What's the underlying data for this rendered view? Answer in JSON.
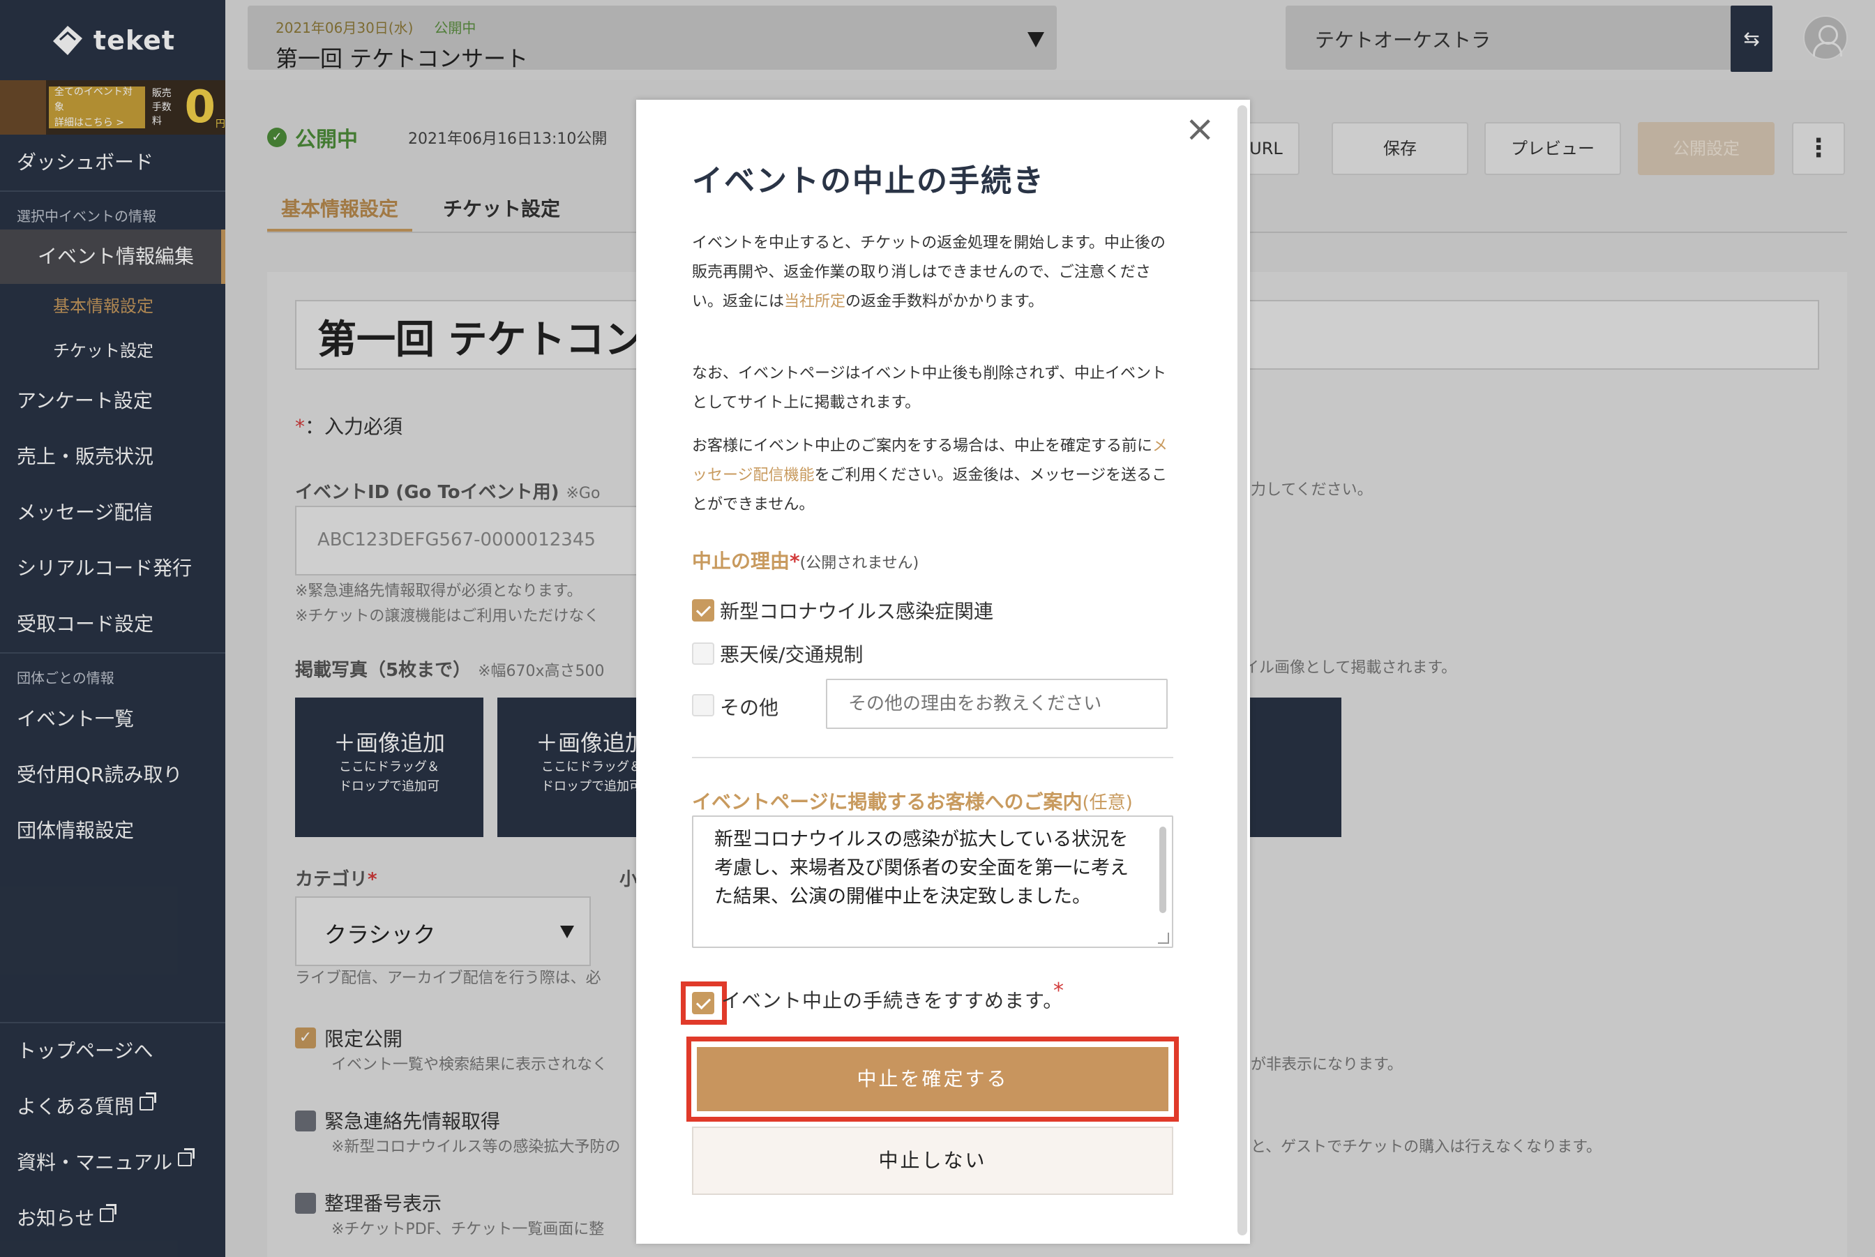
{
  "sidebar": {
    "brand": "teket",
    "banner": {
      "line1": "全てのイベント対象",
      "line2": "詳細はこちら >",
      "fee_label_1": "販売",
      "fee_label_2": "手数料",
      "zero": "0",
      "yen": "円"
    },
    "dashboard": "ダッシュボード",
    "section_event": "選択中イベントの情報",
    "active_item": "イベント情報編集",
    "sub_basic": "基本情報設定",
    "sub_ticket": "チケット設定",
    "items_event": [
      "アンケート設定",
      "売上・販売状況",
      "メッセージ配信",
      "シリアルコード発行",
      "受取コード設定"
    ],
    "section_group": "団体ごとの情報",
    "items_group": [
      "イベント一覧",
      "受付用QR読み取り",
      "団体情報設定"
    ],
    "footer_items": [
      "トップページへ",
      "よくある質問",
      "資料・マニュアル",
      "お知らせ"
    ]
  },
  "topbar": {
    "event_date": "2021年06月30日(水)",
    "event_status": "公開中",
    "event_name": "第一回 テケトコンサート",
    "org_name": "テケトオーケストラ",
    "switch_icon": "⇆"
  },
  "main": {
    "status": "公開中",
    "status_icon": "✓",
    "published_at": "2021年06月16日13:10公開",
    "buttons": {
      "url": "トURL",
      "save": "保存",
      "preview": "プレビュー",
      "publish": "公開設定",
      "more": "⋮"
    },
    "tabs": [
      "基本情報設定",
      "チケット設定"
    ],
    "title_value": "第一回 テケトコン",
    "req_star": "*",
    "req_note": "：入力必須",
    "event_id_label": "イベントID (Go Toイベント用)",
    "event_id_help": "※Go",
    "event_id_help_right": "力してください。",
    "event_id_value": "ABC123DEFG567-0000012345",
    "id_notes": [
      "※緊急連絡先情報取得が必須となります。",
      "※チケットの譲渡機能はご利用いただけなく"
    ],
    "photos_label": "掲載写真（5枚まで）",
    "photos_help": "※幅670x高さ500",
    "photos_help_right": "イル画像として掲載されます。",
    "photo_add": "＋画像追加",
    "photo_drop_1": "ここにドラッグ＆",
    "photo_drop_2": "ドロップで追加可",
    "category_label": "カテゴリ",
    "category_star": "*",
    "subcategory_label": "小",
    "category_value": "クラシック",
    "category_help": "ライブ配信、アーカイブ配信を行う際は、必",
    "limited_label": "限定公開",
    "limited_help": "イベント一覧や検索結果に表示されなく",
    "limited_help_right": "が非表示になります。",
    "emergency_label": "緊急連絡先情報取得",
    "emergency_help": "※新型コロナウイルス等の感染拡大予防の",
    "emergency_help_right": "と、ゲストでチケットの購入は行えなくなります。",
    "seq_label": "整理番号表示",
    "seq_help": "※チケットPDF、チケット一覧画面に整"
  },
  "modal": {
    "close": "×",
    "title": "イベントの中止の手続き",
    "p1_a": "イベントを中止すると、チケットの返金処理を開始します。中止後の販売再開や、返金作業の取り消しはできませんので、ご注意ください。返金には",
    "p1_link": "当社所定",
    "p1_b": "の返金手数料がかかります。",
    "p2": "なお、イベントページはイベント中止後も削除されず、中止イベントとしてサイト上に掲載されます。",
    "p3_a": "お客様にイベント中止のご案内をする場合は、中止を確定する前に",
    "p3_link": "メッセージ配信機能",
    "p3_b": "をご利用ください。返金後は、メッセージを送ることができません。",
    "reason_title": "中止の理由",
    "reason_star": "*",
    "reason_sub": "(公開されません)",
    "reasons": [
      "新型コロナウイルス感染症関連",
      "悪天候/交通規制",
      "その他"
    ],
    "other_placeholder": "その他の理由をお教えください",
    "notice_title": "イベントページに掲載するお客様へのご案内",
    "notice_optional": "(任意)",
    "notice_text": "新型コロナウイルスの感染が拡大している状況を考慮し、来場者及び関係者の安全面を第一に考えた結果、公演の開催中止を決定致しました。",
    "confirm_label": "イベント中止の手続きをすすめます。",
    "confirm_star": "*",
    "confirm_button": "中止を確定する",
    "cancel_button": "中止しない"
  },
  "colors": {
    "sidebar": "#2a3446",
    "accent": "#c89a5e",
    "highlight": "#e03a2a",
    "published": "#4d8c3a"
  }
}
